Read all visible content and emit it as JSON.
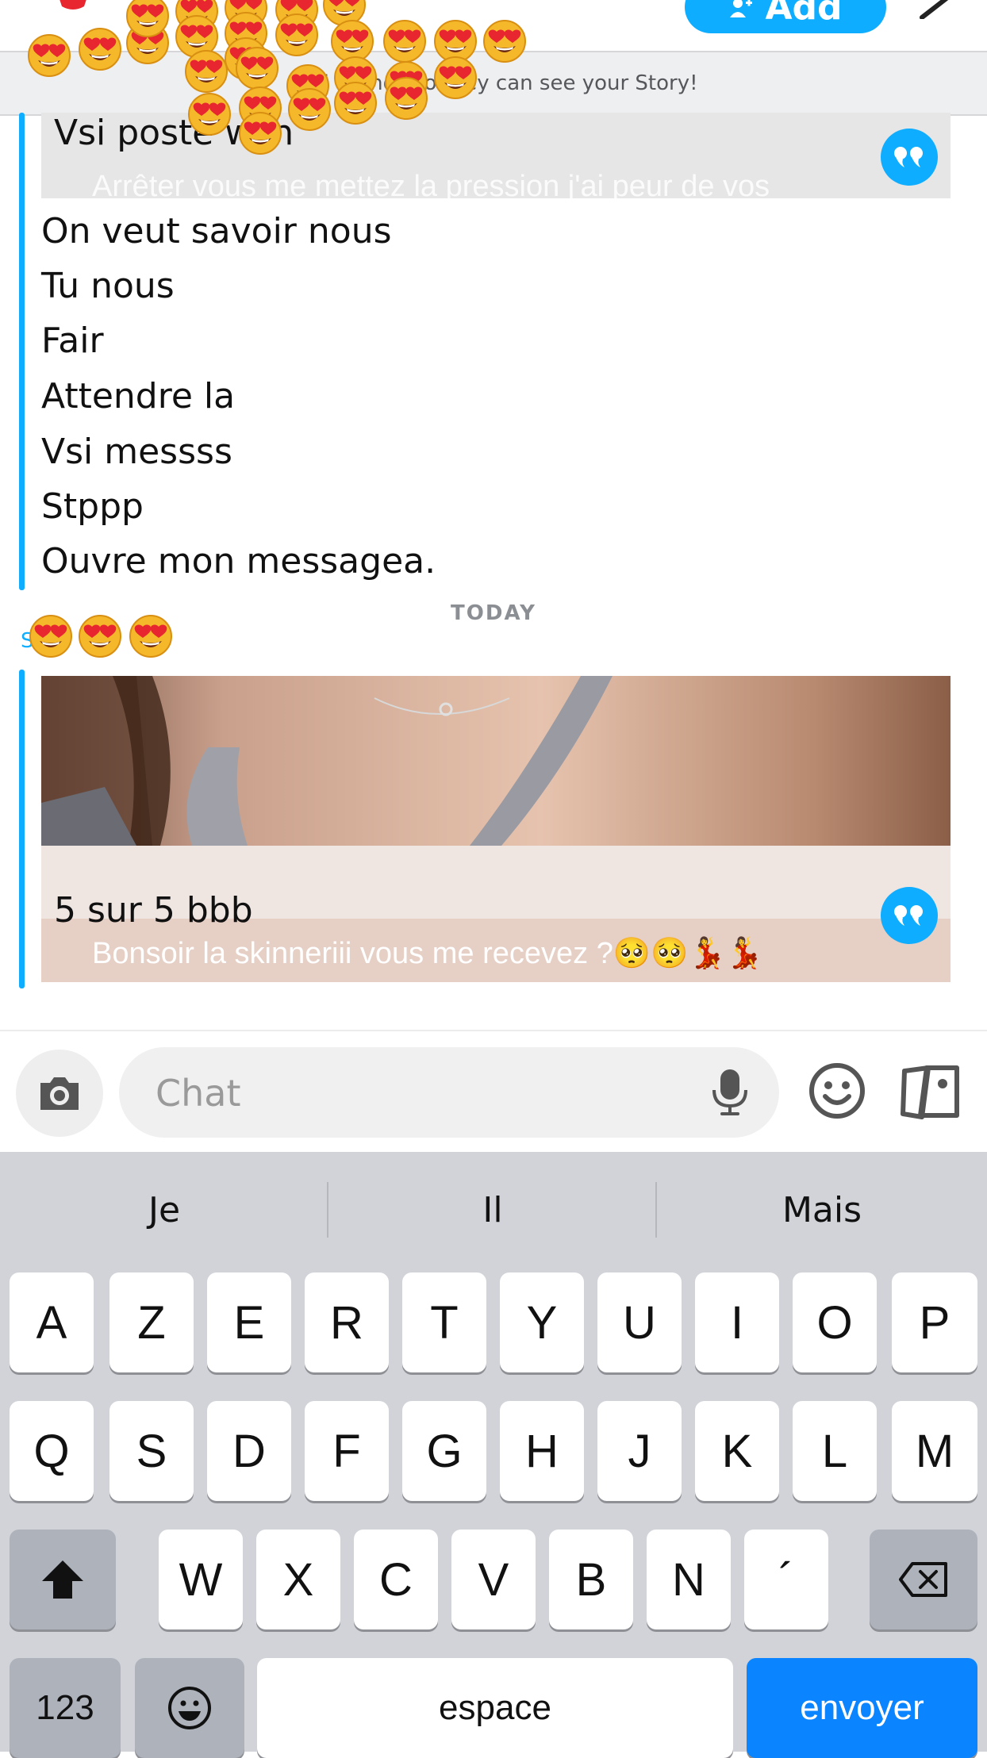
{
  "header": {
    "add_label": "Add"
  },
  "banner": {
    "text": "Add friends so they can see your Story!"
  },
  "messages_prev": {
    "card_title": "Vsi poste wsh",
    "card_caption": "Arrêter vous me mettez la pression j'ai peur de vos",
    "lines": [
      "On veut savoir nous",
      "Tu nous",
      "Fair",
      "Attendre la",
      "Vsi messss",
      "Stppp",
      "Ouvre mon messagea."
    ]
  },
  "date_separator": "TODAY",
  "sender": "SI",
  "reply": {
    "card_title": "5 sur 5 bbb",
    "caption": "Bonsoir la skinneriii vous me recevez ?🥺🥺💃💃"
  },
  "input": {
    "placeholder": "Chat"
  },
  "keyboard": {
    "suggestions": [
      "Je",
      "Il",
      "Mais"
    ],
    "row1": [
      "A",
      "Z",
      "E",
      "R",
      "T",
      "Y",
      "U",
      "I",
      "O",
      "P"
    ],
    "row2": [
      "Q",
      "S",
      "D",
      "F",
      "G",
      "H",
      "J",
      "K",
      "L",
      "M"
    ],
    "row3": [
      "W",
      "X",
      "C",
      "V",
      "B",
      "N",
      "´"
    ],
    "numbers_label": "123",
    "space_label": "espace",
    "send_label": "envoyer"
  },
  "colors": {
    "accent": "#0fadff",
    "keyboard_bg": "#d1d3d9",
    "send_key": "#0a84ff"
  }
}
